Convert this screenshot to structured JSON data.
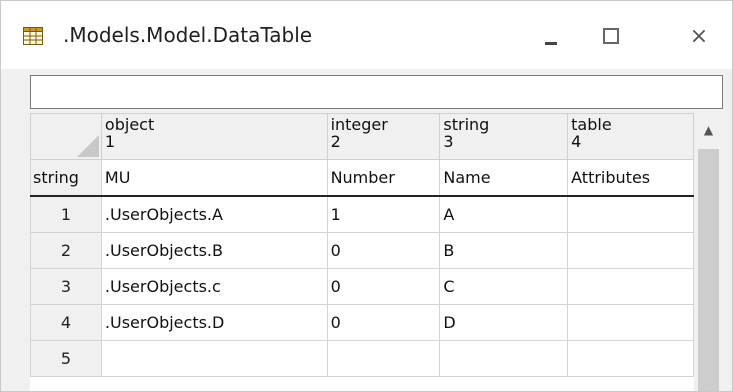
{
  "window": {
    "title": ".Models.Model.DataTable",
    "icons": {
      "app": "grid-table-icon",
      "minimize": "minimize-icon",
      "maximize": "maximize-icon",
      "close": "close-icon"
    },
    "minimize_glyph": "",
    "close_glyph": "×"
  },
  "filter": {
    "value": ""
  },
  "table": {
    "columns": [
      {
        "type": "object",
        "index": "1",
        "label": "MU"
      },
      {
        "type": "integer",
        "index": "2",
        "label": "Number"
      },
      {
        "type": "string",
        "index": "3",
        "label": "Name"
      },
      {
        "type": "table",
        "index": "4",
        "label": "Attributes"
      }
    ],
    "row_header_label": "string",
    "rows": [
      {
        "index": "1",
        "cells": [
          ".UserObjects.A",
          "1",
          "A",
          ""
        ]
      },
      {
        "index": "2",
        "cells": [
          ".UserObjects.B",
          "0",
          "B",
          ""
        ]
      },
      {
        "index": "3",
        "cells": [
          ".UserObjects.c",
          "0",
          "C",
          ""
        ]
      },
      {
        "index": "4",
        "cells": [
          ".UserObjects.D",
          "0",
          "D",
          ""
        ]
      },
      {
        "index": "5",
        "cells": [
          "",
          "",
          "",
          ""
        ]
      }
    ]
  },
  "scrollbar": {
    "up_arrow": "▲"
  },
  "colors": {
    "header_bg": "#f0f0f0",
    "grid_line": "#d4d4d4",
    "scroll_thumb": "#cdcdcd"
  }
}
